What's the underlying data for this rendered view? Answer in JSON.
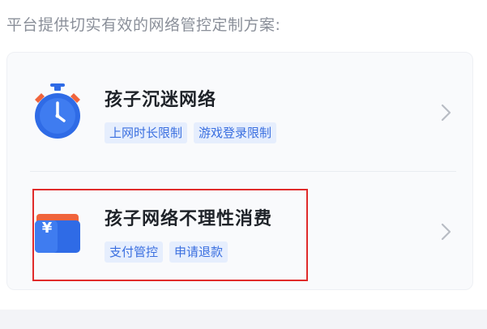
{
  "intro": "平台提供切实有效的网络管控定制方案:",
  "options": [
    {
      "title": "孩子沉迷网络",
      "icon": "alarm-clock-icon",
      "tags": [
        "上网时长限制",
        "游戏登录限制"
      ]
    },
    {
      "title": "孩子网络不理性消费",
      "icon": "yuan-wallet-icon",
      "tags": [
        "支付管控",
        "申请退款"
      ]
    }
  ],
  "colors": {
    "accent": "#3a6fe0",
    "tag_bg": "#e6eefd",
    "highlight": "#e02b2b",
    "icon_blue": "#2f6be6",
    "icon_orange": "#f0643c"
  }
}
